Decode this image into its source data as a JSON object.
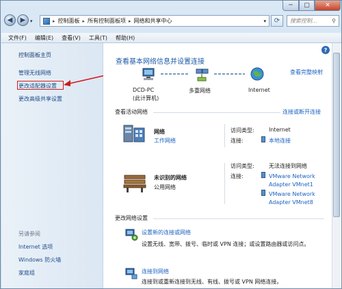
{
  "address": {
    "crumbs": [
      "控制面板",
      "所有控制面板项",
      "网络和共享中心"
    ],
    "search_placeholder": "搜索控制..."
  },
  "menu": [
    "文件(F)",
    "编辑(E)",
    "查看(V)",
    "工具(T)",
    "帮助(H)"
  ],
  "sidebar": {
    "home": "控制面板主页",
    "items": [
      "管理无线网络",
      "更改适配器设置",
      "更改高级共享设置"
    ],
    "see_also_title": "另请参阅",
    "see_also": [
      "Internet 选项",
      "Windows 防火墙",
      "家庭组"
    ]
  },
  "main": {
    "title": "查看基本网络信息并设置连接",
    "full_map": "查看完整映射",
    "nodes": {
      "pc": "DCD-PC",
      "pc_sub": "(此计算机)",
      "multi": "多重网络",
      "internet": "Internet"
    },
    "active_title": "查看活动网络",
    "connect_toggle": "连接或断开连接",
    "networks": [
      {
        "name": "网络",
        "type": "工作网络",
        "access_label": "访问类型:",
        "access_value": "Internet",
        "conn_label": "连接:",
        "conn_value": "本地连接"
      },
      {
        "name": "未识别的网络",
        "type": "公用网络",
        "access_label": "访问类型:",
        "access_value": "无法连接到网络",
        "conn_label": "连接:",
        "conn_value1": "VMware Network Adapter VMnet1",
        "conn_value2": "VMware Network Adapter VMnet8"
      }
    ],
    "change_title": "更改网络设置",
    "tasks": [
      {
        "title": "设置新的连接或网络",
        "desc": "设置无线、宽带、拨号、临时或 VPN 连接；或设置路由器或访问点。"
      },
      {
        "title": "连接到网络",
        "desc": "连接到或重新连接到无线、有线、拨号或 VPN 网络连接。"
      }
    ]
  },
  "colors": {
    "link": "#1b63c0",
    "title": "#1c5aa6",
    "annotation_arrow": "#d11a1a"
  }
}
